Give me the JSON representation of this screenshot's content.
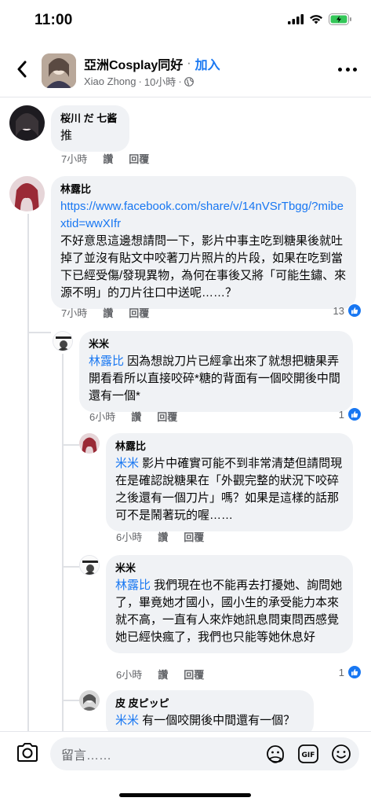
{
  "status": {
    "time": "11:00"
  },
  "header": {
    "group_name": "亞洲Cosplay同好",
    "separator": "·",
    "join": "加入",
    "poster": "Xiao Zhong",
    "post_time": "10小時",
    "sub_separator": "·"
  },
  "comments": [
    {
      "author": "桜川 だ 七酱",
      "text": "推",
      "time": "7小時",
      "like": "讚",
      "reply": "回覆",
      "count": ""
    },
    {
      "author": "林露比",
      "link": "https://www.facebook.com/share/v/14nVSrTbgg/?mibextid=wwXIfr",
      "text": "不好意思這邊想請問一下，影片中事主吃到糖果後就吐掉了並沒有貼文中咬著刀片照片的片段，如果在吃到當下已經受傷/發現異物，為何在事後又將「可能生鏽、來源不明」的刀片往口中送呢……？",
      "time": "7小時",
      "like": "讚",
      "reply": "回覆",
      "count": "13"
    },
    {
      "author": "米米",
      "mention": "林露比",
      "text": " 因為想說刀片已經拿出來了就想把糖果弄開看看所以直接咬碎*糖的背面有一個咬開後中間還有一個*",
      "time": "6小時",
      "like": "讚",
      "reply": "回覆",
      "count": "1"
    },
    {
      "author": "林露比",
      "mention": "米米",
      "text": " 影片中確實可能不到非常清楚但請問現在是確認說糖果在「外觀完整的狀況下咬碎之後還有一個刀片」嗎？如果是這樣的話那可不是鬧著玩的喔……",
      "time": "6小時",
      "like": "讚",
      "reply": "回覆",
      "count": ""
    },
    {
      "author": "米米",
      "mention": "林露比",
      "text": " 我們現在也不能再去打擾她、詢問她了，畢竟她才國小，國小生的承受能力本來就不高，一直有人來炸她訊息問東問西感覺她已經快瘋了，我們也只能等她休息好",
      "time": "6小時",
      "like": "讚",
      "reply": "回覆",
      "count": "1"
    },
    {
      "author": "皮 皮ピッピ",
      "mention": "米米",
      "text": " 有一個咬開後中間還有一個？",
      "time": "",
      "like": "",
      "reply": "",
      "count": ""
    }
  ],
  "composer": {
    "placeholder": "留言……"
  },
  "colors": {
    "accent": "#1877f2",
    "bubble": "#f0f2f5",
    "meta": "#65676b"
  },
  "icons": [
    "back-arrow-icon",
    "globe-icon",
    "more-icon",
    "like-icon",
    "camera-icon",
    "sticker-icon",
    "gif-icon",
    "emoji-icon",
    "signal-icon",
    "wifi-icon",
    "battery-icon"
  ]
}
